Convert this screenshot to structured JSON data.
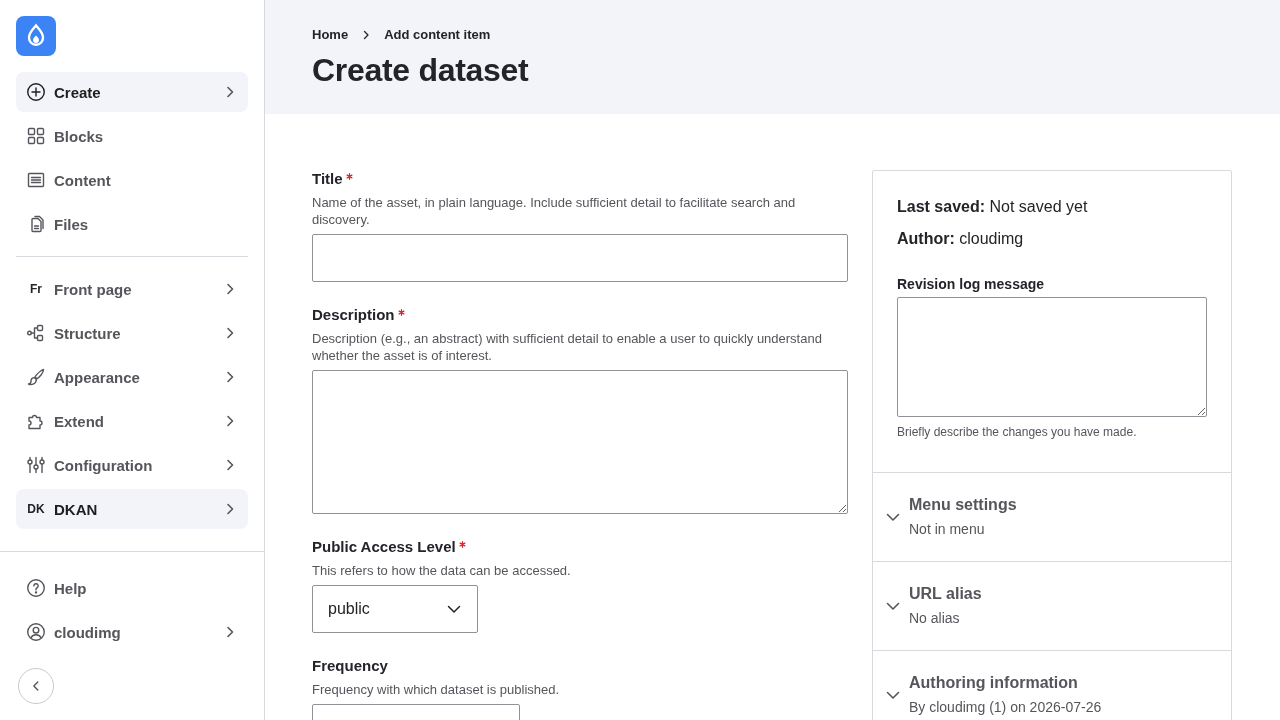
{
  "sidebar": {
    "sections": [
      {
        "items": [
          {
            "label": "Create",
            "kind": "icon",
            "selected": true,
            "expandable": true
          },
          {
            "label": "Blocks",
            "kind": "icon",
            "selected": false,
            "expandable": false
          },
          {
            "label": "Content",
            "kind": "icon",
            "selected": false,
            "expandable": false
          },
          {
            "label": "Files",
            "kind": "icon",
            "selected": false,
            "expandable": false
          }
        ]
      },
      {
        "items": [
          {
            "label": "Front page",
            "kind": "abbr",
            "abbr": "Fr",
            "selected": false,
            "expandable": true
          },
          {
            "label": "Structure",
            "kind": "icon",
            "selected": false,
            "expandable": true
          },
          {
            "label": "Appearance",
            "kind": "icon",
            "selected": false,
            "expandable": true
          },
          {
            "label": "Extend",
            "kind": "icon",
            "selected": false,
            "expandable": true
          },
          {
            "label": "Configuration",
            "kind": "icon",
            "selected": false,
            "expandable": true
          },
          {
            "label": "DKAN",
            "kind": "abbr",
            "abbr": "DK",
            "selected": true,
            "expandable": true
          }
        ]
      }
    ],
    "footer_items": [
      {
        "label": "Help",
        "expandable": false
      },
      {
        "label": "cloudimg",
        "expandable": true
      }
    ]
  },
  "breadcrumb": [
    "Home",
    "Add content item"
  ],
  "page_title": "Create dataset",
  "form": {
    "fields": [
      {
        "kind": "text",
        "label": "Title",
        "required": true,
        "description": "Name of the asset, in plain language. Include sufficient detail to facilitate search and discovery."
      },
      {
        "kind": "textarea",
        "label": "Description",
        "required": true,
        "description": "Description (e.g., an abstract) with sufficient detail to enable a user to quickly understand whether the asset is of interest."
      },
      {
        "kind": "select",
        "label": "Public Access Level",
        "required": true,
        "description": "This refers to how the data can be accessed.",
        "value": "public"
      },
      {
        "kind": "select",
        "label": "Frequency",
        "required": false,
        "description": "Frequency with which dataset is published."
      }
    ]
  },
  "side_panel": {
    "meta": [
      "**Last saved:** Not saved yet",
      "**Author:** cloudimg"
    ],
    "revision_log": {
      "label": "Revision log message",
      "help": "Briefly describe the changes you have made."
    },
    "accordions": [
      {
        "title": "Menu settings",
        "summary": "Not in menu",
        "expanded": false
      },
      {
        "title": "URL alias",
        "summary": "No alias",
        "expanded": false
      },
      {
        "title": "Authoring information",
        "summary": "By cloudimg (1) on 2026-07-26",
        "expanded": false
      }
    ]
  }
}
